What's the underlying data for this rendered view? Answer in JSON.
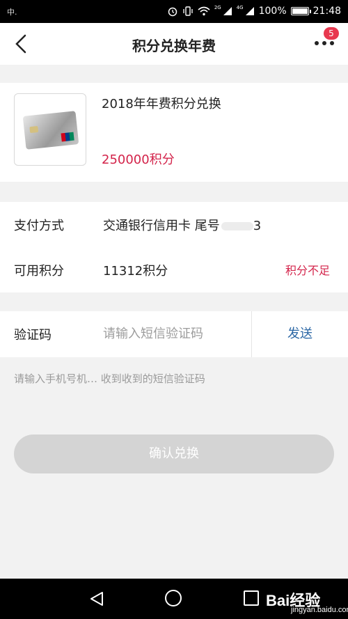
{
  "status_bar": {
    "left_text": "中.",
    "network_2g": "2G",
    "network_4g": "4G",
    "battery": "100%",
    "battery_level": 1.0,
    "time": "21:48"
  },
  "nav": {
    "title": "积分兑换年费",
    "badge_count": "5"
  },
  "product": {
    "name": "2018年年费积分兑换",
    "price": "250000积分"
  },
  "payment": {
    "label": "支付方式",
    "value": "交通银行信用卡 尾号",
    "tail": "3"
  },
  "points": {
    "label": "可用积分",
    "value": "11312积分",
    "warning": "积分不足"
  },
  "verify": {
    "label": "验证码",
    "placeholder": "请输入短信验证码",
    "send_label": "发送"
  },
  "hint": "请输入手机号机… 收到收到的短信验证码",
  "confirm_label": "确认兑换",
  "watermark": {
    "brand": "Bai经验",
    "url": "jingyan.baidu.com"
  },
  "colors": {
    "accent_red": "#d3234a",
    "link_blue": "#2b67a5",
    "disabled_button": "#d4d4d4"
  }
}
